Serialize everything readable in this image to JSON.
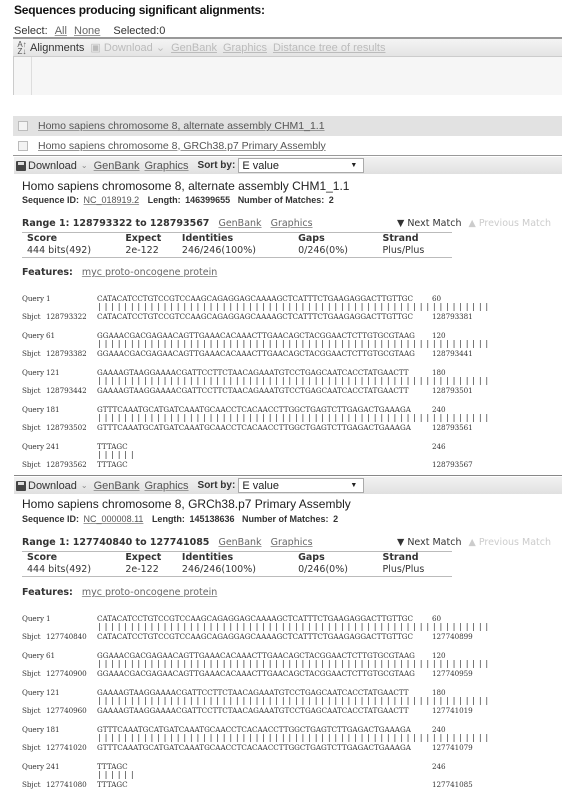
{
  "heading": "Sequences producing significant alignments:",
  "select": {
    "label": "Select:",
    "all": "All",
    "none": "None",
    "selected": "Selected:0"
  },
  "desc_toolbar": {
    "alignments": "Alignments",
    "download": "Download",
    "genbank": "GenBank",
    "graphics": "Graphics",
    "distance_tree": "Distance tree of results"
  },
  "desc_rows": [
    {
      "title": "Homo sapiens chromosome 8, alternate assembly CHM1_1.1",
      "checked": false
    },
    {
      "title": "Homo sapiens chromosome 8, GRCh38.p7 Primary Assembly",
      "checked": false
    }
  ],
  "aln_toolbar": {
    "download": "Download",
    "genbank": "GenBank",
    "graphics": "Graphics",
    "sort_label": "Sort by:",
    "sort_value": "E value"
  },
  "hits": [
    {
      "title": "Homo sapiens chromosome 8, alternate assembly CHM1_1.1",
      "seq_id_label": "Sequence ID:",
      "seq_id": "NC_018919.2",
      "length_label": "Length:",
      "length": "146399655",
      "matches_label": "Number of Matches:",
      "matches": "2",
      "range": "Range 1: 128793322 to 128793567",
      "range_genbank": "GenBank",
      "range_graphics": "Graphics",
      "next_match": "▼ Next Match",
      "prev_match": "▲ Previous Match",
      "stats_headers": [
        "Score",
        "Expect",
        "Identities",
        "Gaps",
        "Strand"
      ],
      "stats_values": [
        "444 bits(492)",
        "2e-122",
        "246/246(100%)",
        "0/246(0%)",
        "Plus/Plus"
      ],
      "features_label": "Features:",
      "feature": "myc proto-oncogene protein",
      "alignment": [
        {
          "q_start": "1",
          "query": "CATACATCCTGTCCGTCCAAGCAGAGGAGCAAAAGCTCATTTCTGAAGAGGACTTGTTGC",
          "q_end": "60",
          "match": "||||||||||||||||||||||||||||||||||||||||||||||||||||||||||||",
          "s_start": "128793322",
          "sbjct": "CATACATCCTGTCCGTCCAAGCAGAGGAGCAAAAGCTCATTTCTGAAGAGGACTTGTTGC",
          "s_end": "128793381"
        },
        {
          "q_start": "61",
          "query": "GGAAACGACGAGAACAGTTGAAACACAAACTTGAACAGCTACGGAACTCTTGTGCGTAAG",
          "q_end": "120",
          "match": "||||||||||||||||||||||||||||||||||||||||||||||||||||||||||||",
          "s_start": "128793382",
          "sbjct": "GGAAACGACGAGAACAGTTGAAACACAAACTTGAACAGCTACGGAACTCTTGTGCGTAAG",
          "s_end": "128793441"
        },
        {
          "q_start": "121",
          "query": "GAAAAGTAAGGAAAACGATTCCTTCTAACAGAAATGTCCTGAGCAATCACCTATGAACTT",
          "q_end": "180",
          "match": "||||||||||||||||||||||||||||||||||||||||||||||||||||||||||||",
          "s_start": "128793442",
          "sbjct": "GAAAAGTAAGGAAAACGATTCCTTCTAACAGAAATGTCCTGAGCAATCACCTATGAACTT",
          "s_end": "128793501"
        },
        {
          "q_start": "181",
          "query": "GTTTCAAATGCATGATCAAATGCAACCTCACAACCTTGGCTGAGTCTTGAGACTGAAAGA",
          "q_end": "240",
          "match": "||||||||||||||||||||||||||||||||||||||||||||||||||||||||||||",
          "s_start": "128793502",
          "sbjct": "GTTTCAAATGCATGATCAAATGCAACCTCACAACCTTGGCTGAGTCTTGAGACTGAAAGA",
          "s_end": "128793561"
        },
        {
          "q_start": "241",
          "query": "TTTAGC",
          "q_end": "246",
          "match": "||||||",
          "s_start": "128793562",
          "sbjct": "TTTAGC",
          "s_end": "128793567"
        }
      ]
    },
    {
      "title": "Homo sapiens chromosome 8, GRCh38.p7 Primary Assembly",
      "seq_id_label": "Sequence ID:",
      "seq_id": "NC_000008.11",
      "length_label": "Length:",
      "length": "145138636",
      "matches_label": "Number of Matches:",
      "matches": "2",
      "range": "Range 1: 127740840 to 127741085",
      "range_genbank": "GenBank",
      "range_graphics": "Graphics",
      "next_match": "▼ Next Match",
      "prev_match": "▲ Previous Match",
      "stats_headers": [
        "Score",
        "Expect",
        "Identities",
        "Gaps",
        "Strand"
      ],
      "stats_values": [
        "444 bits(492)",
        "2e-122",
        "246/246(100%)",
        "0/246(0%)",
        "Plus/Plus"
      ],
      "features_label": "Features:",
      "feature": "myc proto-oncogene protein",
      "alignment": [
        {
          "q_start": "1",
          "query": "CATACATCCTGTCCGTCCAAGCAGAGGAGCAAAAGCTCATTTCTGAAGAGGACTTGTTGC",
          "q_end": "60",
          "match": "||||||||||||||||||||||||||||||||||||||||||||||||||||||||||||",
          "s_start": "127740840",
          "sbjct": "CATACATCCTGTCCGTCCAAGCAGAGGAGCAAAAGCTCATTTCTGAAGAGGACTTGTTGC",
          "s_end": "127740899"
        },
        {
          "q_start": "61",
          "query": "GGAAACGACGAGAACAGTTGAAACACAAACTTGAACAGCTACGGAACTCTTGTGCGTAAG",
          "q_end": "120",
          "match": "||||||||||||||||||||||||||||||||||||||||||||||||||||||||||||",
          "s_start": "127740900",
          "sbjct": "GGAAACGACGAGAACAGTTGAAACACAAACTTGAACAGCTACGGAACTCTTGTGCGTAAG",
          "s_end": "127740959"
        },
        {
          "q_start": "121",
          "query": "GAAAAGTAAGGAAAACGATTCCTTCTAACAGAAATGTCCTGAGCAATCACCTATGAACTT",
          "q_end": "180",
          "match": "||||||||||||||||||||||||||||||||||||||||||||||||||||||||||||",
          "s_start": "127740960",
          "sbjct": "GAAAAGTAAGGAAAACGATTCCTTCTAACAGAAATGTCCTGAGCAATCACCTATGAACTT",
          "s_end": "127741019"
        },
        {
          "q_start": "181",
          "query": "GTTTCAAATGCATGATCAAATGCAACCTCACAACCTTGGCTGAGTCTTGAGACTGAAAGA",
          "q_end": "240",
          "match": "||||||||||||||||||||||||||||||||||||||||||||||||||||||||||||",
          "s_start": "127741020",
          "sbjct": "GTTTCAAATGCATGATCAAATGCAACCTCACAACCTTGGCTGAGTCTTGAGACTGAAAGA",
          "s_end": "127741079"
        },
        {
          "q_start": "241",
          "query": "TTTAGC",
          "q_end": "246",
          "match": "||||||",
          "s_start": "127741080",
          "sbjct": "TTTAGC",
          "s_end": "127741085"
        }
      ]
    }
  ],
  "labels": {
    "query": "Query",
    "sbjct": "Sbjct"
  }
}
